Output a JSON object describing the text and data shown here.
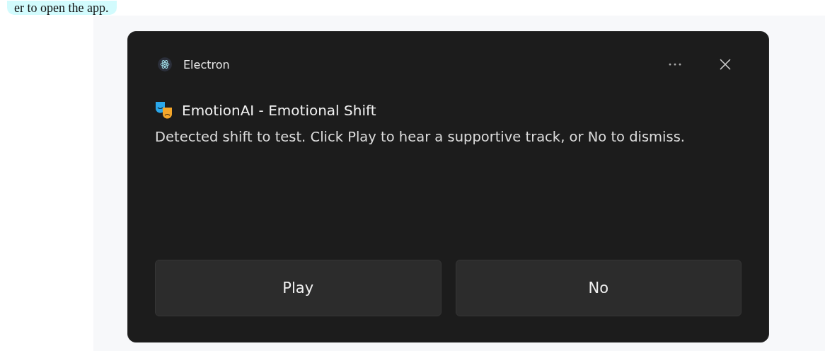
{
  "page_text": "er to open the app.",
  "notification": {
    "app_name": "Electron",
    "title": "EmotionAI - Emotional Shift",
    "message": "Detected shift to test. Click Play to hear a supportive track, or No to dismiss.",
    "buttons": [
      {
        "label": "Play"
      },
      {
        "label": "No"
      }
    ]
  }
}
